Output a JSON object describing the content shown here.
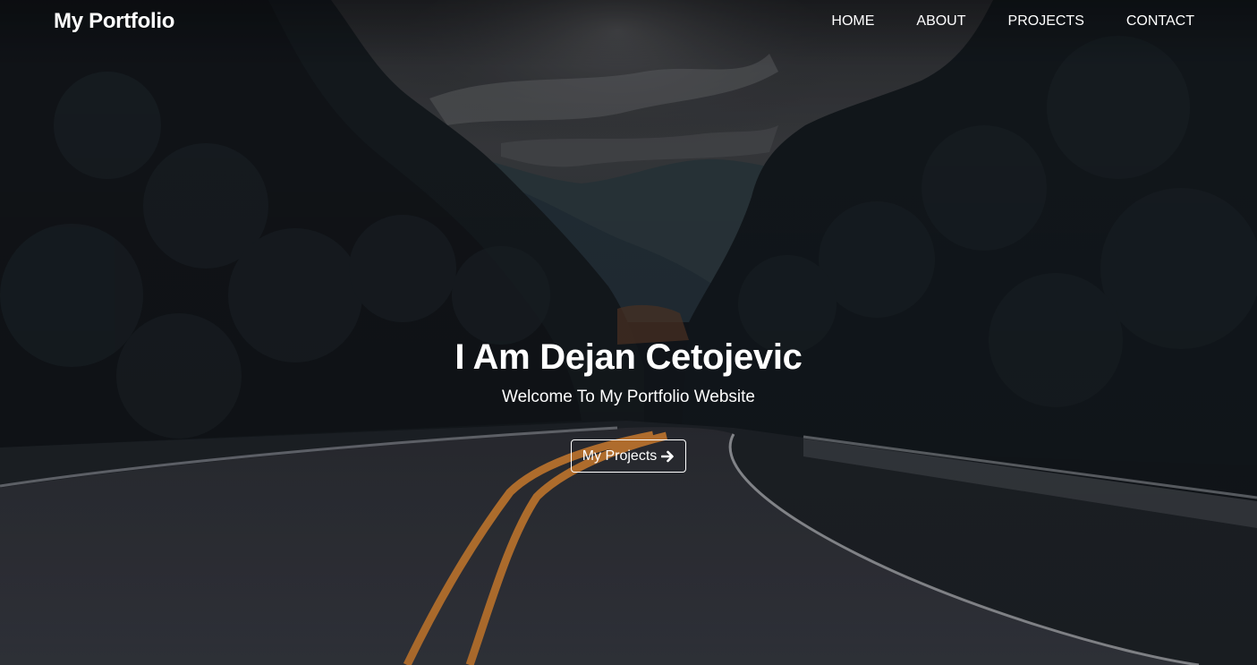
{
  "navbar": {
    "brand": "My Portfolio",
    "links": [
      {
        "label": "HOME"
      },
      {
        "label": "ABOUT"
      },
      {
        "label": "PROJECTS"
      },
      {
        "label": "CONTACT"
      }
    ]
  },
  "hero": {
    "title": "I Am Dejan Cetojevic",
    "subtitle": "Welcome To My Portfolio Website",
    "button_label": "My Projects",
    "button_icon": "arrow-right-icon",
    "background": "dark forest road photo"
  },
  "colors": {
    "text": "#ffffff",
    "road_line": "#e08a35",
    "overlay": "#0e1318"
  }
}
